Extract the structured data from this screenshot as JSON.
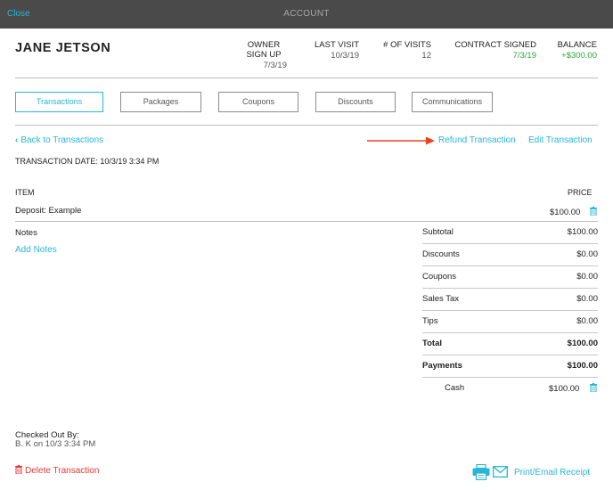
{
  "topbar": {
    "close_label": "Close",
    "title": "ACCOUNT"
  },
  "customer": {
    "name": "JANE JETSON"
  },
  "stats": {
    "owner_signup": {
      "label_line1": "OWNER",
      "label_line2": "SIGN UP",
      "value": "7/3/19"
    },
    "last_visit": {
      "label": "LAST VISIT",
      "value": "10/3/19"
    },
    "visits": {
      "label": "# OF VISITS",
      "value": "12"
    },
    "contract": {
      "label": "CONTRACT SIGNED",
      "value": "7/3/19"
    },
    "balance": {
      "label": "BALANCE",
      "value": "+$300.00"
    }
  },
  "tabs": [
    "Transactions",
    "Packages",
    "Coupons",
    "Discounts",
    "Communications"
  ],
  "nav": {
    "back_label": "Back to Transactions",
    "refund_label": "Refund Transaction",
    "edit_label": "Edit Transaction"
  },
  "transaction": {
    "date_label": "TRANSACTION DATE: 10/3/19 3:34 PM",
    "item_header": "ITEM",
    "price_header": "PRICE",
    "item_name": "Deposit: Example",
    "item_price": "$100.00"
  },
  "notes": {
    "label": "Notes",
    "add_label": "Add Notes"
  },
  "summary": {
    "subtotal": {
      "label": "Subtotal",
      "value": "$100.00"
    },
    "discounts": {
      "label": "Discounts",
      "value": "$0.00"
    },
    "coupons": {
      "label": "Coupons",
      "value": "$0.00"
    },
    "sales_tax": {
      "label": "Sales Tax",
      "value": "$0.00"
    },
    "tips": {
      "label": "Tips",
      "value": "$0.00"
    },
    "total": {
      "label": "Total",
      "value": "$100.00"
    },
    "payments": {
      "label": "Payments",
      "value": "$100.00"
    },
    "cash": {
      "label": "Cash",
      "value": "$100.00"
    }
  },
  "checkout": {
    "label": "Checked Out By:",
    "value": "B. K on 10/3 3:34 PM"
  },
  "footer": {
    "delete_label": "Delete Transaction",
    "print_label": "Print/Email Receipt"
  },
  "colors": {
    "accent": "#29b6d6",
    "positive": "#2aa836",
    "danger": "#e53935",
    "annotation_arrow": "#f0401e"
  }
}
